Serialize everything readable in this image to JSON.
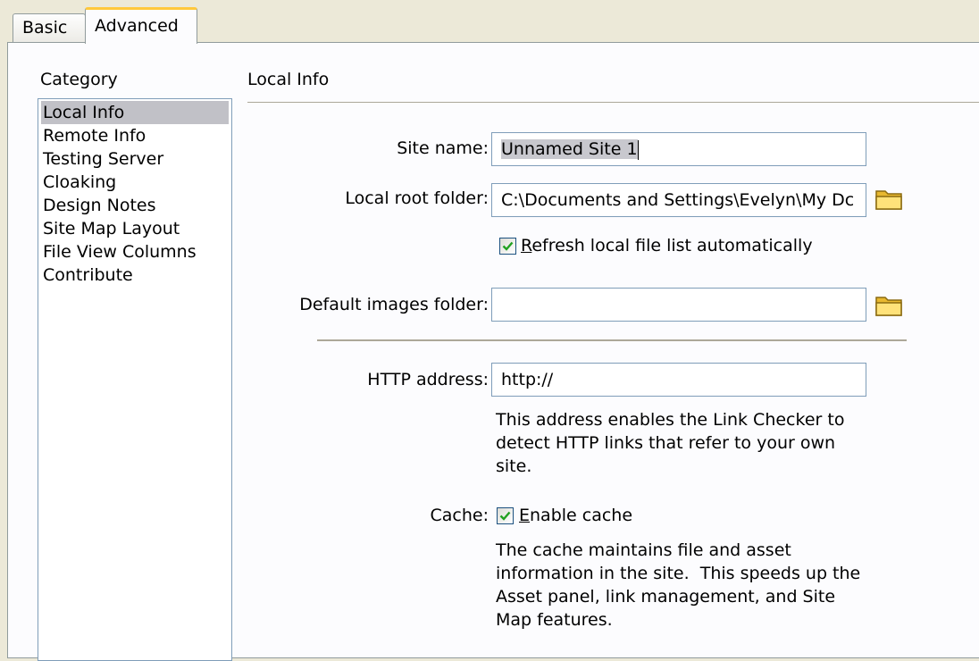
{
  "tabs": {
    "basic": "Basic",
    "advanced": "Advanced"
  },
  "category": {
    "label": "Category",
    "items": [
      "Local Info",
      "Remote Info",
      "Testing Server",
      "Cloaking",
      "Design Notes",
      "Site Map Layout",
      "File View Columns",
      "Contribute"
    ],
    "selected_index": 0
  },
  "section": {
    "title": "Local Info"
  },
  "site_name": {
    "label": "Site name:",
    "value": "Unnamed Site 1"
  },
  "local_root": {
    "label": "Local root folder:",
    "value": "C:\\Documents and Settings\\Evelyn\\My Dc"
  },
  "refresh": {
    "checked": true,
    "underlined_char": "R",
    "label_rest": "efresh local file list automatically"
  },
  "default_images": {
    "label": "Default images folder:",
    "value": ""
  },
  "http": {
    "label": "HTTP address:",
    "value": "http://",
    "help_lines": [
      "This address enables the Link Checker to",
      "detect HTTP links that refer to your own",
      "site."
    ]
  },
  "cache": {
    "label": "Cache:",
    "checked": true,
    "underlined_char": "E",
    "label_rest": "nable cache",
    "help_lines": [
      "The cache maintains file and asset",
      "information in the site.  This speeds up the",
      "Asset panel, link management, and Site",
      "Map features."
    ]
  },
  "icons": {
    "folder": "folder-icon",
    "check": "check-icon"
  },
  "colors": {
    "tab_accent": "#ffc83c",
    "selection": "#c1c1c7",
    "field_border": "#7f9db9",
    "check_green": "#21a121"
  }
}
